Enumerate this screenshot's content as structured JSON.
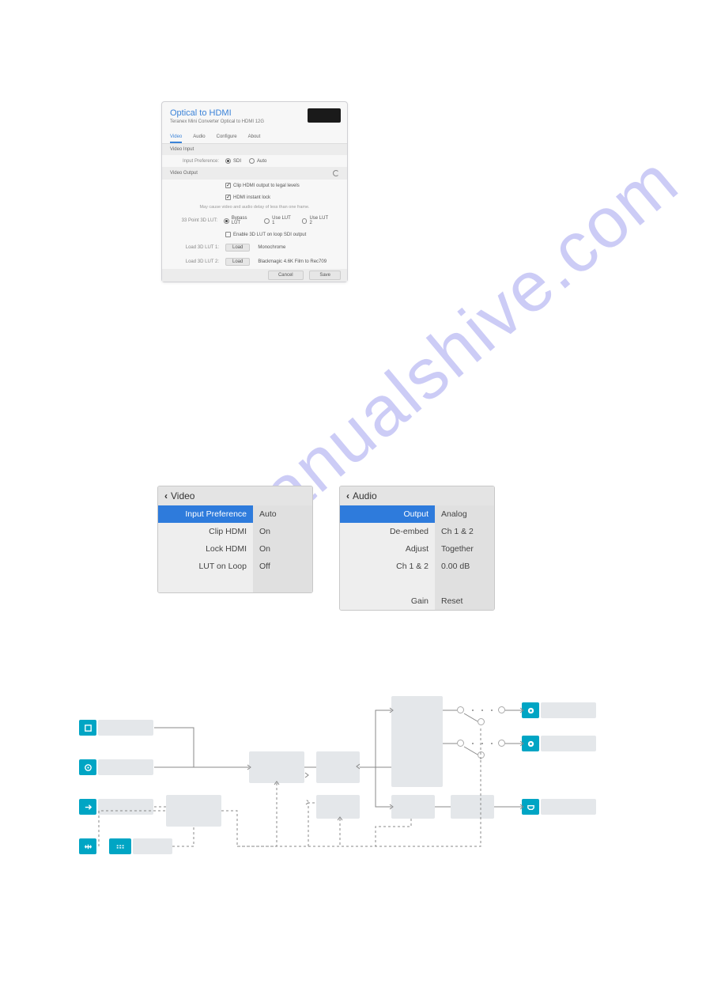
{
  "watermark": "manualshive.com",
  "dialog": {
    "title": "Optical to HDMI",
    "subtitle": "Teranex Mini Converter Optical to HDMI 12G",
    "tabs": [
      "Video",
      "Audio",
      "Configure",
      "About"
    ],
    "video_input_label": "Video Input",
    "input_preference_label": "Input Preference:",
    "input_pref_sdi": "SDI",
    "input_pref_auto": "Auto",
    "video_output_label": "Video Output",
    "clip_hdmi": "Clip HDMI output to legal levels",
    "instant_lock": "HDMI instant lock",
    "note": "May cause video and audio delay of less than one frame.",
    "lut_label": "33 Point 3D LUT:",
    "bypass_lut": "Bypass LUT",
    "use_lut1": "Use LUT 1",
    "use_lut2": "Use LUT 2",
    "enable_loop": "Enable 3D LUT on loop SDI output",
    "load_lut1_label": "Load 3D LUT 1:",
    "load_lut2_label": "Load 3D LUT 2:",
    "load_btn": "Load",
    "lut1_name": "Monochrome",
    "lut2_name": "Blackmagic 4.6K Film to Rec709",
    "cancel": "Cancel",
    "save": "Save"
  },
  "video_panel": {
    "title": "Video",
    "rows": [
      {
        "k": "Input Preference",
        "v": "Auto",
        "sel": true
      },
      {
        "k": "Clip HDMI",
        "v": "On"
      },
      {
        "k": "Lock HDMI",
        "v": "On"
      },
      {
        "k": "LUT on Loop",
        "v": "Off"
      }
    ]
  },
  "audio_panel": {
    "title": "Audio",
    "rows": [
      {
        "k": "Output",
        "v": "Analog",
        "sel": true
      },
      {
        "k": "De-embed",
        "v": "Ch 1 & 2"
      },
      {
        "k": "Adjust",
        "v": "Together"
      },
      {
        "k": "Ch 1 & 2",
        "v": "0.00 dB"
      }
    ],
    "gain_k": "Gain",
    "gain_v": "Reset"
  }
}
